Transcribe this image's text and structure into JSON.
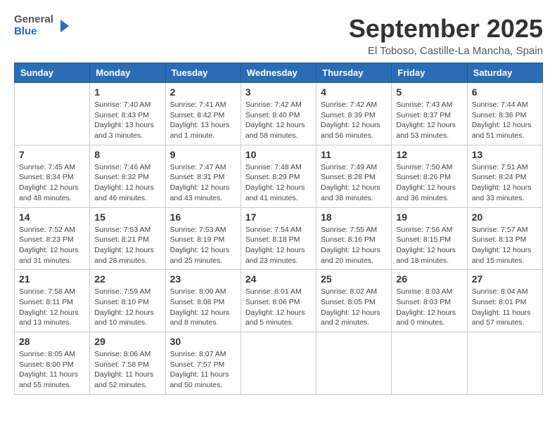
{
  "logo": {
    "text_general": "General",
    "text_blue": "Blue"
  },
  "header": {
    "month": "September 2025",
    "location": "El Toboso, Castille-La Mancha, Spain"
  },
  "weekdays": [
    "Sunday",
    "Monday",
    "Tuesday",
    "Wednesday",
    "Thursday",
    "Friday",
    "Saturday"
  ],
  "weeks": [
    [
      {
        "day": "",
        "sunrise": "",
        "sunset": "",
        "daylight": ""
      },
      {
        "day": "1",
        "sunrise": "Sunrise: 7:40 AM",
        "sunset": "Sunset: 8:43 PM",
        "daylight": "Daylight: 13 hours and 3 minutes."
      },
      {
        "day": "2",
        "sunrise": "Sunrise: 7:41 AM",
        "sunset": "Sunset: 8:42 PM",
        "daylight": "Daylight: 13 hours and 1 minute."
      },
      {
        "day": "3",
        "sunrise": "Sunrise: 7:42 AM",
        "sunset": "Sunset: 8:40 PM",
        "daylight": "Daylight: 12 hours and 58 minutes."
      },
      {
        "day": "4",
        "sunrise": "Sunrise: 7:42 AM",
        "sunset": "Sunset: 8:39 PM",
        "daylight": "Daylight: 12 hours and 56 minutes."
      },
      {
        "day": "5",
        "sunrise": "Sunrise: 7:43 AM",
        "sunset": "Sunset: 8:37 PM",
        "daylight": "Daylight: 12 hours and 53 minutes."
      },
      {
        "day": "6",
        "sunrise": "Sunrise: 7:44 AM",
        "sunset": "Sunset: 8:36 PM",
        "daylight": "Daylight: 12 hours and 51 minutes."
      }
    ],
    [
      {
        "day": "7",
        "sunrise": "Sunrise: 7:45 AM",
        "sunset": "Sunset: 8:34 PM",
        "daylight": "Daylight: 12 hours and 48 minutes."
      },
      {
        "day": "8",
        "sunrise": "Sunrise: 7:46 AM",
        "sunset": "Sunset: 8:32 PM",
        "daylight": "Daylight: 12 hours and 46 minutes."
      },
      {
        "day": "9",
        "sunrise": "Sunrise: 7:47 AM",
        "sunset": "Sunset: 8:31 PM",
        "daylight": "Daylight: 12 hours and 43 minutes."
      },
      {
        "day": "10",
        "sunrise": "Sunrise: 7:48 AM",
        "sunset": "Sunset: 8:29 PM",
        "daylight": "Daylight: 12 hours and 41 minutes."
      },
      {
        "day": "11",
        "sunrise": "Sunrise: 7:49 AM",
        "sunset": "Sunset: 8:28 PM",
        "daylight": "Daylight: 12 hours and 38 minutes."
      },
      {
        "day": "12",
        "sunrise": "Sunrise: 7:50 AM",
        "sunset": "Sunset: 8:26 PM",
        "daylight": "Daylight: 12 hours and 36 minutes."
      },
      {
        "day": "13",
        "sunrise": "Sunrise: 7:51 AM",
        "sunset": "Sunset: 8:24 PM",
        "daylight": "Daylight: 12 hours and 33 minutes."
      }
    ],
    [
      {
        "day": "14",
        "sunrise": "Sunrise: 7:52 AM",
        "sunset": "Sunset: 8:23 PM",
        "daylight": "Daylight: 12 hours and 31 minutes."
      },
      {
        "day": "15",
        "sunrise": "Sunrise: 7:53 AM",
        "sunset": "Sunset: 8:21 PM",
        "daylight": "Daylight: 12 hours and 28 minutes."
      },
      {
        "day": "16",
        "sunrise": "Sunrise: 7:53 AM",
        "sunset": "Sunset: 8:19 PM",
        "daylight": "Daylight: 12 hours and 25 minutes."
      },
      {
        "day": "17",
        "sunrise": "Sunrise: 7:54 AM",
        "sunset": "Sunset: 8:18 PM",
        "daylight": "Daylight: 12 hours and 23 minutes."
      },
      {
        "day": "18",
        "sunrise": "Sunrise: 7:55 AM",
        "sunset": "Sunset: 8:16 PM",
        "daylight": "Daylight: 12 hours and 20 minutes."
      },
      {
        "day": "19",
        "sunrise": "Sunrise: 7:56 AM",
        "sunset": "Sunset: 8:15 PM",
        "daylight": "Daylight: 12 hours and 18 minutes."
      },
      {
        "day": "20",
        "sunrise": "Sunrise: 7:57 AM",
        "sunset": "Sunset: 8:13 PM",
        "daylight": "Daylight: 12 hours and 15 minutes."
      }
    ],
    [
      {
        "day": "21",
        "sunrise": "Sunrise: 7:58 AM",
        "sunset": "Sunset: 8:11 PM",
        "daylight": "Daylight: 12 hours and 13 minutes."
      },
      {
        "day": "22",
        "sunrise": "Sunrise: 7:59 AM",
        "sunset": "Sunset: 8:10 PM",
        "daylight": "Daylight: 12 hours and 10 minutes."
      },
      {
        "day": "23",
        "sunrise": "Sunrise: 8:00 AM",
        "sunset": "Sunset: 8:08 PM",
        "daylight": "Daylight: 12 hours and 8 minutes."
      },
      {
        "day": "24",
        "sunrise": "Sunrise: 8:01 AM",
        "sunset": "Sunset: 8:06 PM",
        "daylight": "Daylight: 12 hours and 5 minutes."
      },
      {
        "day": "25",
        "sunrise": "Sunrise: 8:02 AM",
        "sunset": "Sunset: 8:05 PM",
        "daylight": "Daylight: 12 hours and 2 minutes."
      },
      {
        "day": "26",
        "sunrise": "Sunrise: 8:03 AM",
        "sunset": "Sunset: 8:03 PM",
        "daylight": "Daylight: 12 hours and 0 minutes."
      },
      {
        "day": "27",
        "sunrise": "Sunrise: 8:04 AM",
        "sunset": "Sunset: 8:01 PM",
        "daylight": "Daylight: 11 hours and 57 minutes."
      }
    ],
    [
      {
        "day": "28",
        "sunrise": "Sunrise: 8:05 AM",
        "sunset": "Sunset: 8:00 PM",
        "daylight": "Daylight: 11 hours and 55 minutes."
      },
      {
        "day": "29",
        "sunrise": "Sunrise: 8:06 AM",
        "sunset": "Sunset: 7:58 PM",
        "daylight": "Daylight: 11 hours and 52 minutes."
      },
      {
        "day": "30",
        "sunrise": "Sunrise: 8:07 AM",
        "sunset": "Sunset: 7:57 PM",
        "daylight": "Daylight: 11 hours and 50 minutes."
      },
      {
        "day": "",
        "sunrise": "",
        "sunset": "",
        "daylight": ""
      },
      {
        "day": "",
        "sunrise": "",
        "sunset": "",
        "daylight": ""
      },
      {
        "day": "",
        "sunrise": "",
        "sunset": "",
        "daylight": ""
      },
      {
        "day": "",
        "sunrise": "",
        "sunset": "",
        "daylight": ""
      }
    ]
  ]
}
